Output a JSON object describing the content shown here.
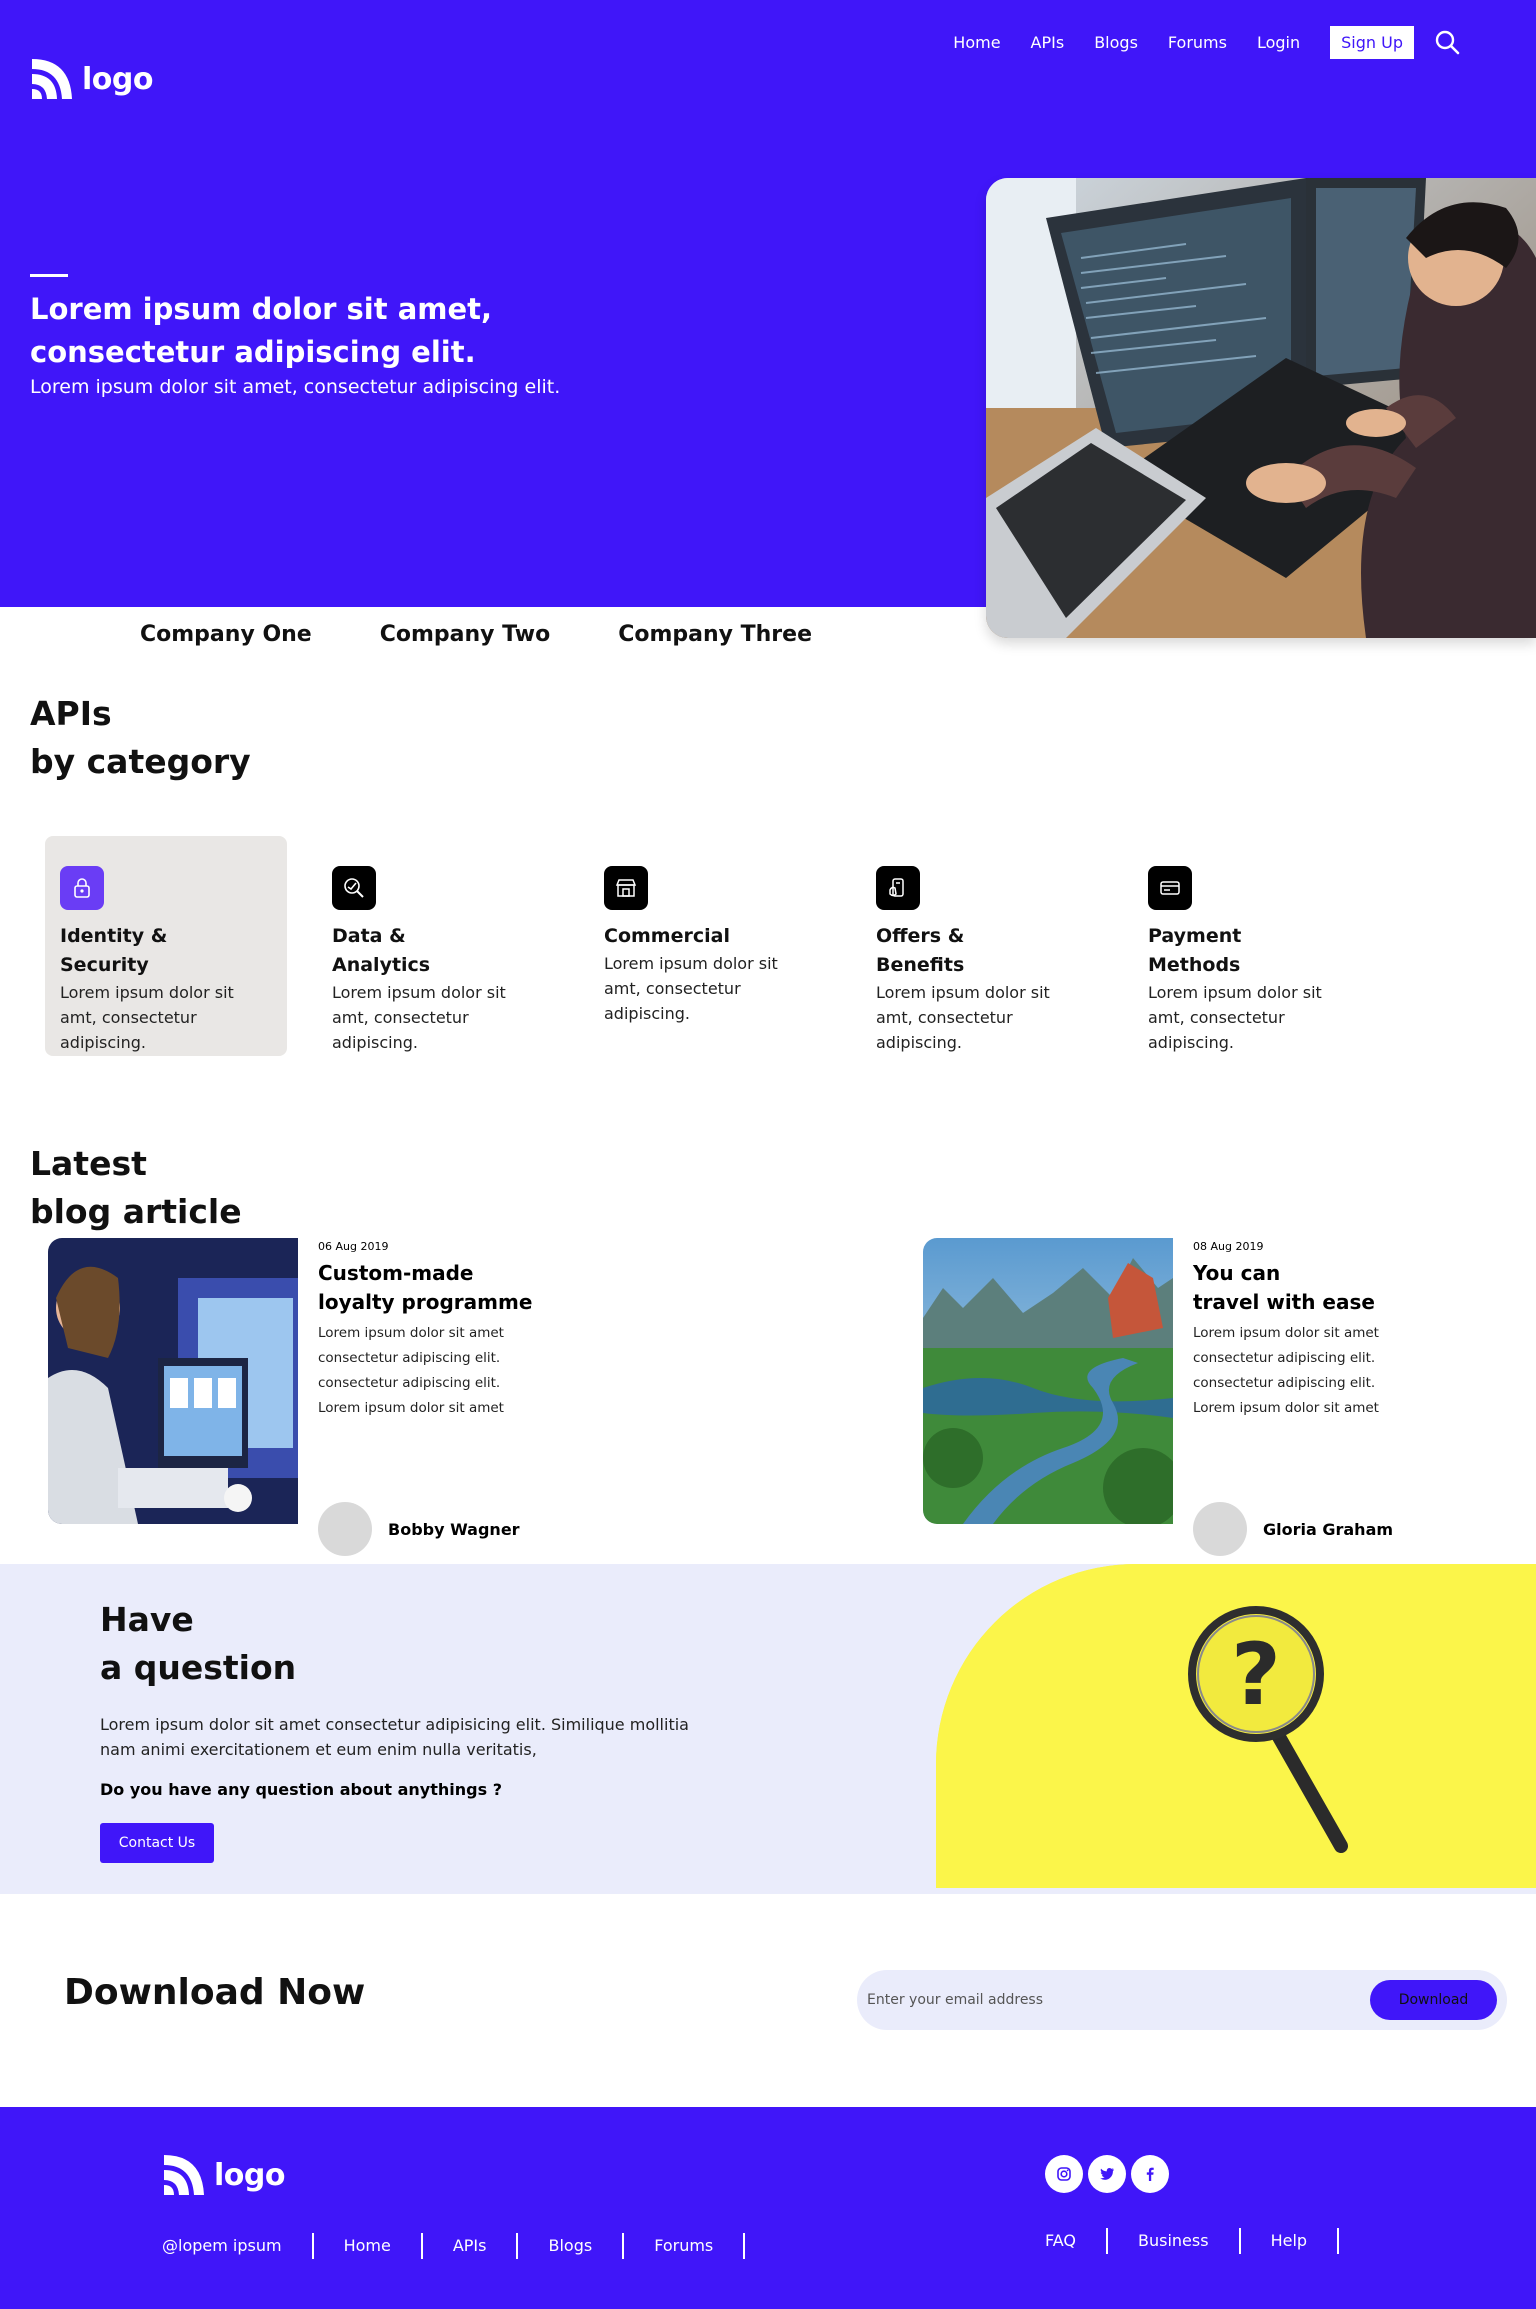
{
  "header": {
    "logo_text": "logo",
    "nav": [
      "Home",
      "APIs",
      "Blogs",
      "Forums",
      "Login"
    ],
    "signup_label": "Sign Up"
  },
  "hero": {
    "title": "Lorem ipsum dolor sit amet, consectetur adipiscing elit.",
    "subtitle": "Lorem ipsum dolor sit amet, consectetur adipiscing elit."
  },
  "companies": [
    "Company One",
    "Company Two",
    "Company Three"
  ],
  "apis": {
    "title_line1": "APIs",
    "title_line2": "by category",
    "categories": [
      {
        "title_a": "Identity &",
        "title_b": "Security",
        "desc": "Lorem ipsum dolor sit amt, consectetur adipiscing.",
        "icon": "lock-icon"
      },
      {
        "title_a": "Data &",
        "title_b": "Analytics",
        "desc": "Lorem ipsum dolor sit amt, consectetur adipiscing.",
        "icon": "analytics-icon"
      },
      {
        "title_a": "Commercial",
        "title_b": "",
        "desc": "Lorem ipsum dolor sit amt, consectetur adipiscing.",
        "icon": "store-icon"
      },
      {
        "title_a": "Offers &",
        "title_b": "Benefits",
        "desc": "Lorem ipsum dolor sit amt, consectetur adipiscing.",
        "icon": "offer-icon"
      },
      {
        "title_a": "Payment",
        "title_b": "Methods",
        "desc": "Lorem ipsum dolor sit amt, consectetur adipiscing.",
        "icon": "card-icon"
      }
    ]
  },
  "blog": {
    "title_line1": "Latest",
    "title_line2": "blog article",
    "articles": [
      {
        "date": "06 Aug 2019",
        "title_a": "Custom-made",
        "title_b": "loyalty programme",
        "lines": [
          "Lorem ipsum dolor sit amet",
          "consectetur adipiscing elit.",
          "consectetur adipiscing elit.",
          "Lorem ipsum dolor sit amet"
        ],
        "author": "Bobby Wagner"
      },
      {
        "date": "08 Aug 2019",
        "title_a": "You can",
        "title_b": "travel with ease",
        "lines": [
          "Lorem ipsum dolor sit amet",
          "consectetur adipiscing elit.",
          "consectetur adipiscing elit.",
          "Lorem ipsum dolor sit amet"
        ],
        "author": "Gloria Graham"
      }
    ]
  },
  "question": {
    "title_line1": "Have",
    "title_line2": "a question",
    "text": "Lorem ipsum dolor sit amet consectetur adipisicing elit. Similique mollitia nam animi exercitationem et eum enim nulla veritatis,",
    "ask": "Do you have any question about anythings ?",
    "button": "Contact Us"
  },
  "download": {
    "title_bold": "Download",
    "title_rest": " Now",
    "placeholder": "Enter your email address",
    "button": "Download"
  },
  "footer": {
    "logo_text": "logo",
    "links_left": [
      "@lopem ipsum",
      "Home",
      "APIs",
      "Blogs",
      "Forums"
    ],
    "links_right": [
      "FAQ",
      "Business",
      "Help"
    ],
    "socials": [
      "instagram-icon",
      "twitter-icon",
      "facebook-icon"
    ]
  },
  "colors": {
    "brand": "#4016f9",
    "light_panel": "#eaecfb",
    "yellow": "#fbf54a"
  }
}
